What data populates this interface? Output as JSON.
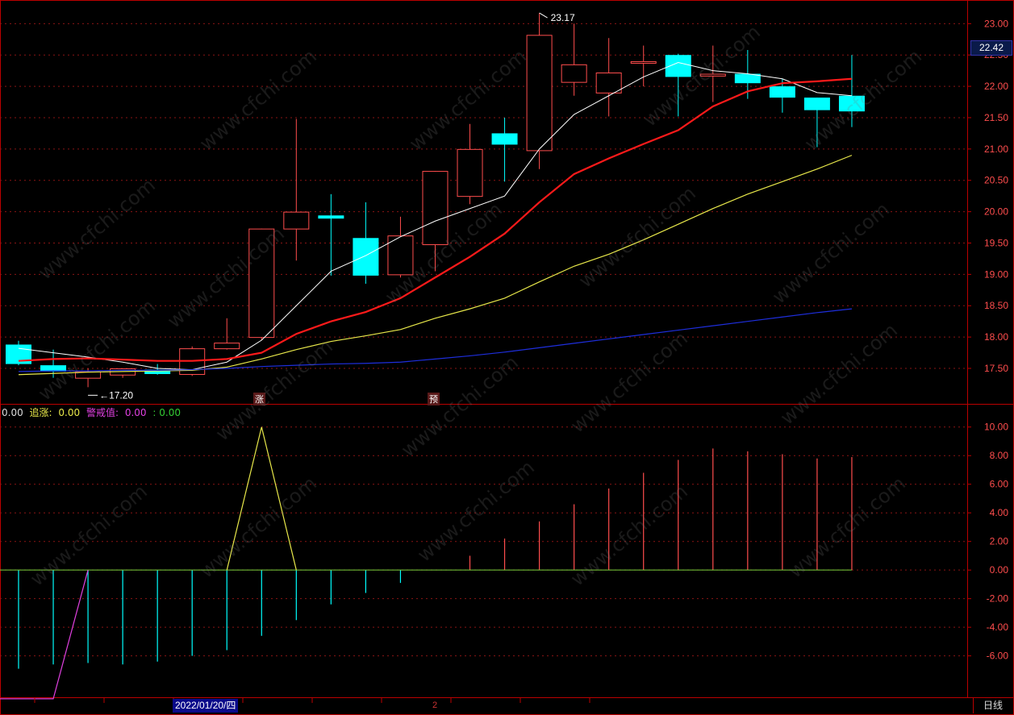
{
  "chart_data": [
    {
      "type": "candlestick",
      "ylim": [
        17.05,
        23.3
      ],
      "yticks": [
        "23.00",
        "22.50",
        "22.00",
        "21.50",
        "21.00",
        "20.50",
        "20.00",
        "19.50",
        "19.00",
        "18.50",
        "18.00",
        "17.50"
      ],
      "candles": [
        {
          "o": 17.57,
          "h": 17.94,
          "l": 17.55,
          "c": 17.88,
          "color": "cyan"
        },
        {
          "o": 17.55,
          "h": 17.8,
          "l": 17.35,
          "c": 17.45,
          "color": "cyan"
        },
        {
          "o": 17.45,
          "h": 17.5,
          "l": 17.2,
          "c": 17.35,
          "color": "red"
        },
        {
          "o": 17.4,
          "h": 17.5,
          "l": 17.35,
          "c": 17.5,
          "color": "red"
        },
        {
          "o": 17.48,
          "h": 17.57,
          "l": 17.4,
          "c": 17.41,
          "color": "cyan"
        },
        {
          "o": 17.41,
          "h": 17.85,
          "l": 17.38,
          "c": 17.82,
          "color": "red"
        },
        {
          "o": 17.82,
          "h": 18.3,
          "l": 17.8,
          "c": 17.91,
          "color": "red"
        },
        {
          "o": 18.0,
          "h": 19.73,
          "l": 17.95,
          "c": 19.73,
          "color": "red"
        },
        {
          "o": 19.73,
          "h": 21.48,
          "l": 19.22,
          "c": 20.0,
          "color": "red"
        },
        {
          "o": 19.94,
          "h": 20.28,
          "l": 18.98,
          "c": 19.89,
          "color": "cyan"
        },
        {
          "o": 19.58,
          "h": 20.15,
          "l": 18.85,
          "c": 18.98,
          "color": "cyan"
        },
        {
          "o": 19.0,
          "h": 19.92,
          "l": 18.95,
          "c": 19.62,
          "color": "red"
        },
        {
          "o": 19.48,
          "h": 20.65,
          "l": 19.05,
          "c": 20.65,
          "color": "red"
        },
        {
          "o": 20.25,
          "h": 21.4,
          "l": 20.12,
          "c": 21.0,
          "color": "red"
        },
        {
          "o": 21.25,
          "h": 21.5,
          "l": 20.48,
          "c": 21.07,
          "color": "cyan"
        },
        {
          "o": 20.98,
          "h": 23.17,
          "l": 20.68,
          "c": 22.82,
          "color": "red"
        },
        {
          "o": 22.07,
          "h": 23.0,
          "l": 21.85,
          "c": 22.35,
          "color": "red"
        },
        {
          "o": 21.9,
          "h": 22.77,
          "l": 21.52,
          "c": 22.22,
          "color": "red"
        },
        {
          "o": 22.4,
          "h": 22.65,
          "l": 22.0,
          "c": 22.4,
          "color": "red"
        },
        {
          "o": 22.5,
          "h": 22.52,
          "l": 21.52,
          "c": 22.15,
          "color": "cyan"
        },
        {
          "o": 22.17,
          "h": 22.65,
          "l": 21.75,
          "c": 22.2,
          "color": "red"
        },
        {
          "o": 22.2,
          "h": 22.58,
          "l": 21.8,
          "c": 22.05,
          "color": "cyan"
        },
        {
          "o": 22.0,
          "h": 22.12,
          "l": 21.58,
          "c": 21.82,
          "color": "cyan"
        },
        {
          "o": 21.82,
          "h": 21.82,
          "l": 21.03,
          "c": 21.62,
          "color": "cyan"
        },
        {
          "o": 21.85,
          "h": 22.5,
          "l": 21.35,
          "c": 21.6,
          "color": "cyan"
        }
      ],
      "ma_lines": [
        {
          "color": "#ffffff",
          "width": 1,
          "values": [
            17.82,
            17.75,
            17.68,
            17.6,
            17.5,
            17.48,
            17.6,
            17.95,
            18.5,
            19.05,
            19.3,
            19.6,
            19.85,
            20.05,
            20.25,
            21.0,
            21.55,
            21.85,
            22.15,
            22.38,
            22.25,
            22.2,
            22.12,
            21.9,
            21.85
          ]
        },
        {
          "color": "#ff1a1a",
          "width": 2.2,
          "values": [
            17.62,
            17.65,
            17.66,
            17.64,
            17.62,
            17.62,
            17.65,
            17.75,
            18.05,
            18.25,
            18.4,
            18.62,
            18.95,
            19.28,
            19.65,
            20.15,
            20.6,
            20.85,
            21.08,
            21.3,
            21.68,
            21.92,
            22.05,
            22.08,
            22.12
          ]
        },
        {
          "color": "#e8e84a",
          "width": 1.2,
          "values": [
            17.4,
            17.42,
            17.44,
            17.45,
            17.46,
            17.47,
            17.52,
            17.65,
            17.8,
            17.93,
            18.02,
            18.12,
            18.3,
            18.45,
            18.62,
            18.88,
            19.13,
            19.32,
            19.55,
            19.8,
            20.05,
            20.28,
            20.48,
            20.68,
            20.9
          ]
        },
        {
          "color": "#1e2edc",
          "width": 1.2,
          "values": [
            17.45,
            17.46,
            17.46,
            17.47,
            17.47,
            17.48,
            17.5,
            17.53,
            17.55,
            17.57,
            17.58,
            17.6,
            17.65,
            17.7,
            17.76,
            17.83,
            17.9,
            17.97,
            18.04,
            18.11,
            18.18,
            18.25,
            18.32,
            18.39,
            18.45
          ]
        }
      ],
      "annotations": {
        "high_label": "23.17",
        "low_label": "17.20",
        "last_price": "22.42"
      }
    },
    {
      "type": "indicator",
      "ylim": [
        -8.5,
        11.0
      ],
      "yticks": [
        "10.00",
        "8.00",
        "6.00",
        "4.00",
        "2.00",
        "0.00",
        "-2.00",
        "-4.00",
        "-6.00"
      ],
      "bars": [
        -6.9,
        -6.6,
        -6.5,
        -6.6,
        -6.4,
        -6.0,
        -5.6,
        -4.6,
        -3.5,
        -2.4,
        -1.6,
        -0.9,
        0,
        1.0,
        2.2,
        3.4,
        4.6,
        5.7,
        6.8,
        7.7,
        8.5,
        8.3,
        8.1,
        7.8,
        7.9
      ],
      "yellow_line": [
        null,
        null,
        null,
        null,
        null,
        null,
        0,
        10.0,
        0,
        null,
        null,
        null,
        null,
        null,
        null,
        null,
        null,
        null,
        null,
        null,
        null,
        null,
        null,
        null,
        null
      ],
      "magenta_line": [
        -9.0,
        -9.0,
        0,
        null,
        null,
        null,
        null,
        null,
        null,
        null,
        null,
        null,
        null,
        null,
        null,
        null,
        null,
        null,
        null,
        null,
        null,
        null,
        null,
        null,
        null
      ],
      "legend": {
        "v0": "0.00",
        "zhui_label": "追涨:",
        "zhui_val": "0.00",
        "jing_label": "警戒值:",
        "jing_val": "0.00",
        "last": ": 0.00"
      }
    }
  ],
  "markers": {
    "zhang": "涨",
    "yu": "预"
  },
  "footer": {
    "date": "2022/01/20/四",
    "page": "2",
    "period": "日线"
  },
  "watermark_text": "www.cfchi.com"
}
